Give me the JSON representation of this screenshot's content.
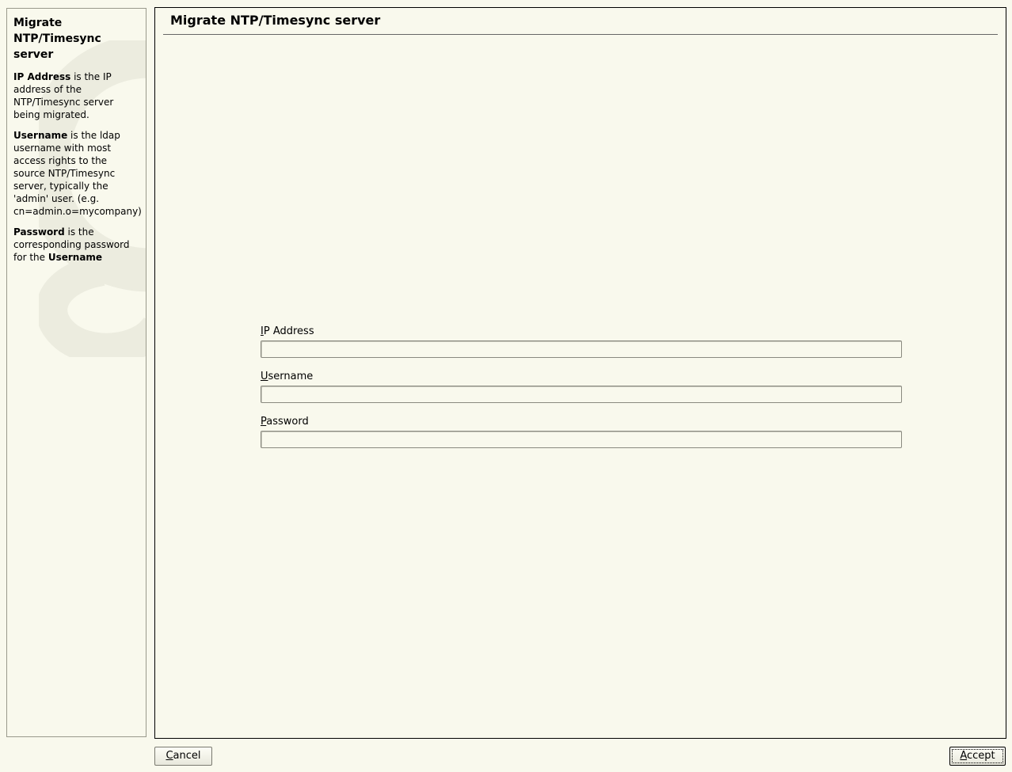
{
  "help": {
    "title": "Migrate NTP/Timesync server",
    "paragraphs": [
      {
        "bold": "IP Address",
        "text": " is the IP address of the NTP/Timesync server being migrated."
      },
      {
        "bold": "Username",
        "text": " is the ldap username with most access rights to the source NTP/Timesync server, typically the 'admin' user. (e.g. cn=admin.o=mycompany)"
      },
      {
        "bold": "Password",
        "text": " is the corresponding password for the ",
        "bold2": "Username"
      }
    ]
  },
  "main": {
    "title": "Migrate NTP/Timesync server",
    "fields": [
      {
        "mnemonic": "I",
        "label_rest": "P Address",
        "value": ""
      },
      {
        "mnemonic": "U",
        "label_rest": "sername",
        "value": ""
      },
      {
        "mnemonic": "P",
        "label_rest": "assword",
        "value": ""
      }
    ]
  },
  "buttons": {
    "cancel": {
      "mnemonic": "C",
      "rest": "ancel"
    },
    "accept": {
      "mnemonic": "A",
      "rest": "ccept"
    }
  }
}
